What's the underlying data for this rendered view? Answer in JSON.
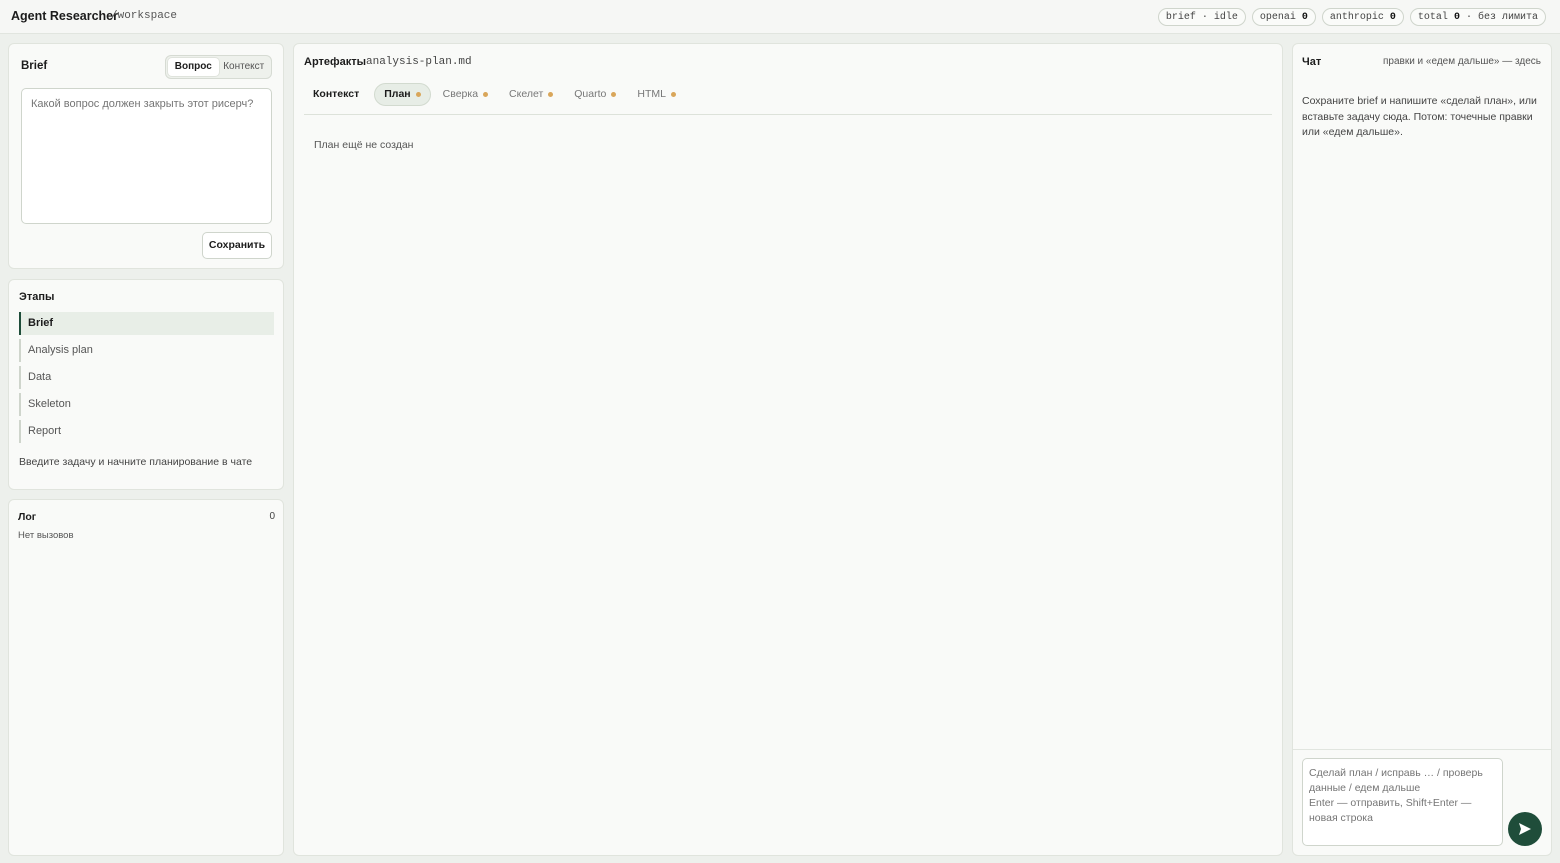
{
  "header": {
    "title": "Agent Researcher",
    "path": "/workspace",
    "badges": {
      "status": "brief · idle",
      "openai_label": "openai",
      "openai_count": "0",
      "anthropic_label": "anthropic",
      "anthropic_count": "0",
      "total_label": "total",
      "total_count": "0",
      "total_suffix": "· без лимита"
    }
  },
  "brief": {
    "title": "Brief",
    "toggle": [
      "Вопрос",
      "Контекст"
    ],
    "placeholder": "Какой вопрос должен закрыть этот рисерч?",
    "save_label": "Сохранить"
  },
  "stages": {
    "title": "Этапы",
    "items": [
      "Brief",
      "Analysis plan",
      "Data",
      "Skeleton",
      "Report"
    ],
    "hint": "Введите задачу и начните планирование в чате"
  },
  "log": {
    "title": "Лог",
    "count": "0",
    "empty": "Нет вызовов"
  },
  "artifacts": {
    "title": "Артефакты",
    "file": "analysis-plan.md",
    "tabs": [
      "Контекст",
      "План",
      "Сверка",
      "Скелет",
      "Quarto",
      "HTML"
    ],
    "empty_message": "План ещё не создан"
  },
  "chat": {
    "title": "Чат",
    "hint": "правки и «едем дальше» — здесь",
    "intro": "Сохраните brief и напишите «сделай план», или вставьте задачу сюда. Потом: точечные правки или «едем дальше».",
    "input_placeholder": "Сделай план / исправь … / проверь данные / едем дальше\nEnter — отправить, Shift+Enter — новая строка"
  },
  "colors": {
    "accent": "#1f4d3a",
    "dot": "#d9a65a",
    "background": "#edf0ec"
  }
}
